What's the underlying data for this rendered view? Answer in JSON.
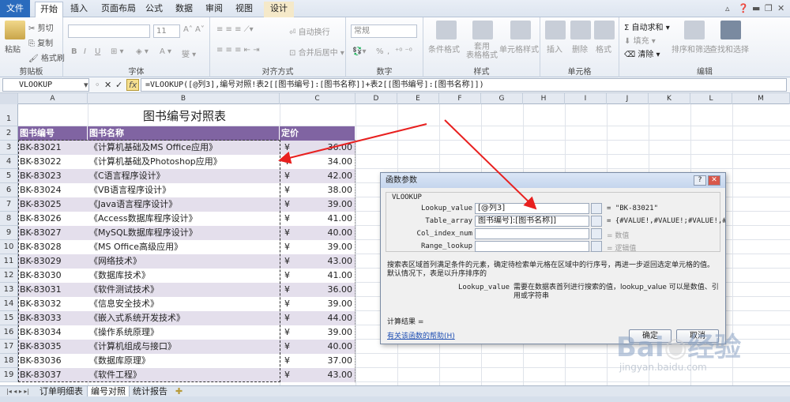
{
  "ribbon": {
    "tabs": [
      "文件",
      "开始",
      "插入",
      "页面布局",
      "公式",
      "数据",
      "审阅",
      "视图",
      "设计"
    ],
    "clipboard": {
      "paste": "粘贴",
      "cut": "剪切",
      "copy": "复制",
      "format_painter": "格式刷",
      "label": "剪贴板"
    },
    "font": {
      "size": "11",
      "label": "字体",
      "bold": "B",
      "italic": "I",
      "underline": "U"
    },
    "alignment": {
      "wrap": "自动换行",
      "merge": "合并后居中",
      "label": "对齐方式"
    },
    "number": {
      "format": "常规",
      "label": "数字",
      "percent": "%",
      "comma": ","
    },
    "styles": {
      "conditional": "条件格式",
      "as_table": "套用\n表格格式",
      "cell_style": "单元格样式",
      "label": "样式"
    },
    "cells": {
      "insert": "插入",
      "delete": "删除",
      "format": "格式",
      "label": "单元格"
    },
    "editing": {
      "autosum": "自动求和",
      "fill": "填充",
      "clear": "清除",
      "sort": "排序和筛选",
      "find": "查找和选择",
      "label": "编辑"
    }
  },
  "formula_bar": {
    "name_box": "VLOOKUP",
    "formula": "=VLOOKUP([@列3],编号对照!表2[[图书编号]:[图书名称]]+表2[[图书编号]:[图书名称]])"
  },
  "columns": [
    "A",
    "B",
    "C",
    "D",
    "E",
    "F",
    "G",
    "H",
    "I",
    "J",
    "K",
    "L",
    "M"
  ],
  "sheet": {
    "title": "图书编号对照表",
    "headers": [
      "图书编号",
      "图书名称",
      "定价"
    ],
    "rows": [
      [
        "BK-83021",
        "《计算机基础及MS Office应用》",
        "¥",
        "36.00"
      ],
      [
        "BK-83022",
        "《计算机基础及Photoshop应用》",
        "¥",
        "34.00"
      ],
      [
        "BK-83023",
        "《C语言程序设计》",
        "¥",
        "42.00"
      ],
      [
        "BK-83024",
        "《VB语言程序设计》",
        "¥",
        "38.00"
      ],
      [
        "BK-83025",
        "《Java语言程序设计》",
        "¥",
        "39.00"
      ],
      [
        "BK-83026",
        "《Access数据库程序设计》",
        "¥",
        "41.00"
      ],
      [
        "BK-83027",
        "《MySQL数据库程序设计》",
        "¥",
        "40.00"
      ],
      [
        "BK-83028",
        "《MS Office高级应用》",
        "¥",
        "39.00"
      ],
      [
        "BK-83029",
        "《网络技术》",
        "¥",
        "43.00"
      ],
      [
        "BK-83030",
        "《数据库技术》",
        "¥",
        "41.00"
      ],
      [
        "BK-83031",
        "《软件测试技术》",
        "¥",
        "36.00"
      ],
      [
        "BK-83032",
        "《信息安全技术》",
        "¥",
        "39.00"
      ],
      [
        "BK-83033",
        "《嵌入式系统开发技术》",
        "¥",
        "44.00"
      ],
      [
        "BK-83034",
        "《操作系统原理》",
        "¥",
        "39.00"
      ],
      [
        "BK-83035",
        "《计算机组成与接口》",
        "¥",
        "40.00"
      ],
      [
        "BK-83036",
        "《数据库原理》",
        "¥",
        "37.00"
      ],
      [
        "BK-83037",
        "《软件工程》",
        "¥",
        "43.00"
      ]
    ]
  },
  "sheet_tabs": [
    "订单明细表",
    "编号对照",
    "统计报告"
  ],
  "dialog": {
    "title": "函数参数",
    "function": "VLOOKUP",
    "args": [
      {
        "name": "Lookup_value",
        "value": "[@列3]",
        "result": "= \"BK-83021\""
      },
      {
        "name": "Table_array",
        "value": "图书编号]:[图书名称]]",
        "result": "= {#VALUE!,#VALUE!;#VALUE!,#VALU..."
      },
      {
        "name": "Col_index_num",
        "value": "",
        "result": "= 数值"
      },
      {
        "name": "Range_lookup",
        "value": "",
        "result": "= 逻辑值"
      }
    ],
    "description": "搜索表区域首列满足条件的元素，确定待检索单元格在区域中的行序号，再进一步返回选定单元格的值。默认情况下，表是以升序排序的",
    "param_name": "Lookup_value",
    "param_desc": "需要在数据表首列进行搜索的值，lookup_value 可以是数值、引用或字符串",
    "calc_result": "计算结果 =",
    "help_link": "有关该函数的帮助(H)",
    "ok": "确定",
    "cancel": "取消"
  },
  "watermark": {
    "text": "Baidu经验",
    "url": "jingyan.baidu.com"
  },
  "colors": {
    "header_fill": "#8064a2",
    "row_band": "#e4dfec",
    "accent_blue": "#2a6bbd",
    "arrow": "#e8201f"
  }
}
